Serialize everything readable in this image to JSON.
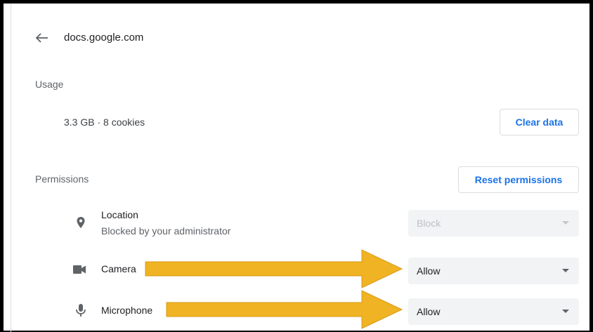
{
  "header": {
    "back_icon": "arrow-back-icon",
    "site": "docs.google.com"
  },
  "usage": {
    "label": "Usage",
    "value": "3.3 GB · 8 cookies",
    "clear_button": "Clear data"
  },
  "permissions": {
    "label": "Permissions",
    "reset_button": "Reset permissions",
    "items": [
      {
        "icon": "location-pin-icon",
        "title": "Location",
        "subtitle": "Blocked by your administrator",
        "value": "Block",
        "disabled": true
      },
      {
        "icon": "camera-icon",
        "title": "Camera",
        "value": "Allow",
        "disabled": false
      },
      {
        "icon": "microphone-icon",
        "title": "Microphone",
        "value": "Allow",
        "disabled": false
      }
    ]
  },
  "annotations": {
    "arrow_color": "#f0b323"
  },
  "colors": {
    "accent": "#1a73e8",
    "select_bg": "#f1f3f4",
    "muted_text": "#5f6368"
  }
}
